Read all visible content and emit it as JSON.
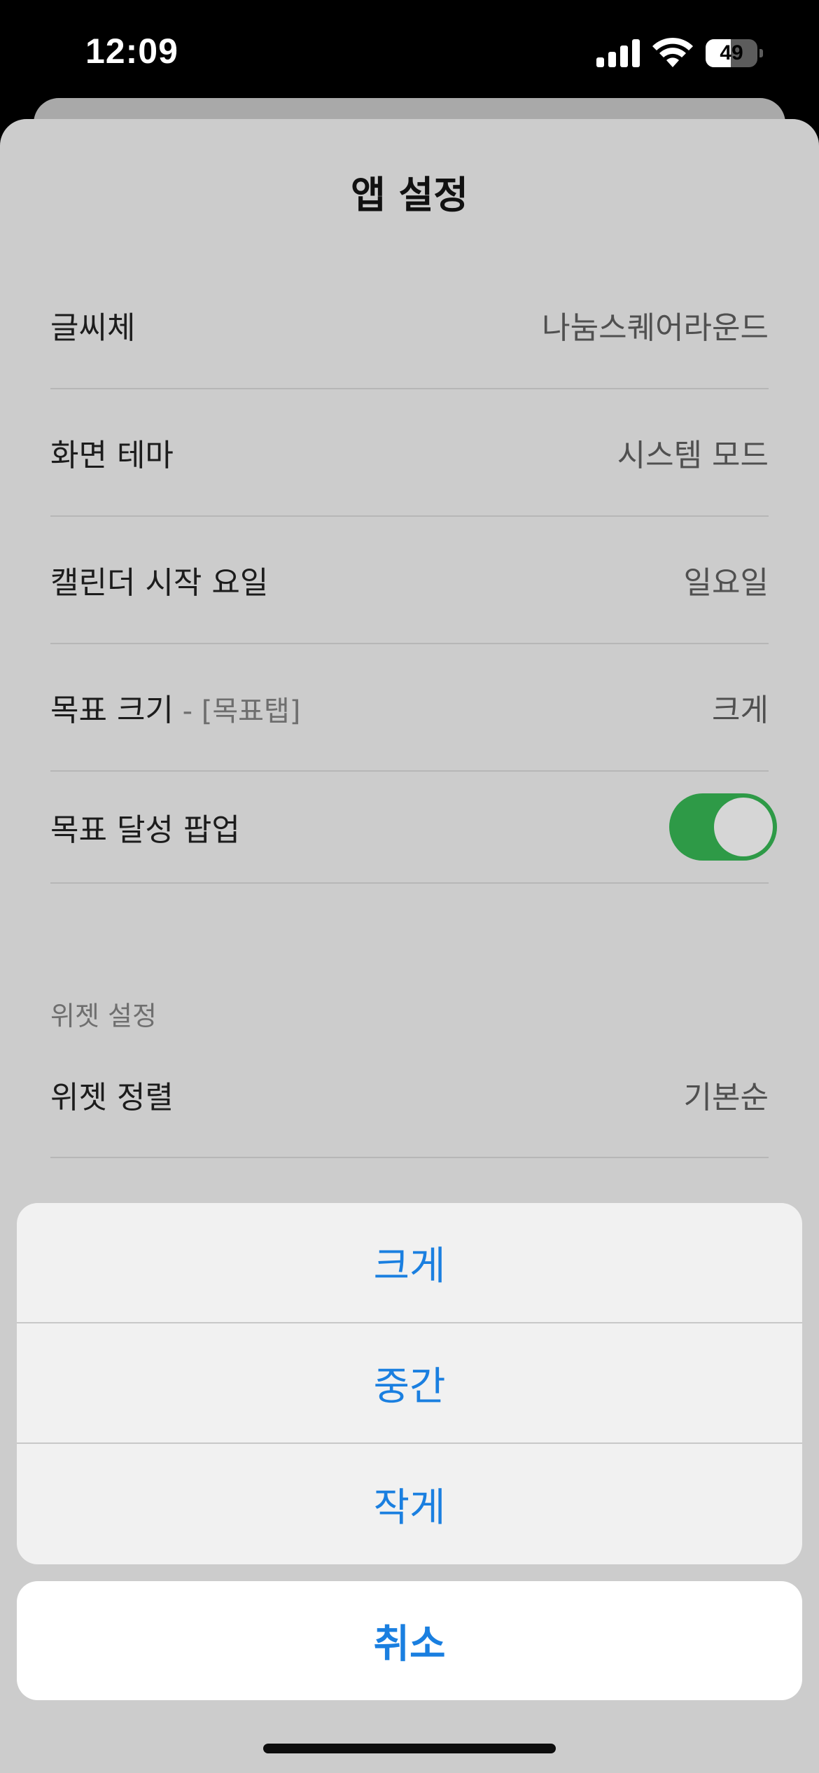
{
  "status_bar": {
    "time": "12:09",
    "battery_level": 49
  },
  "sheet": {
    "title": "앱 설정",
    "rows": [
      {
        "label": "글씨체",
        "sub": "",
        "value": "나눔스퀘어라운드"
      },
      {
        "label": "화면 테마",
        "sub": "",
        "value": "시스템 모드"
      },
      {
        "label": "캘린더 시작 요일",
        "sub": "",
        "value": "일요일"
      },
      {
        "label": "목표 크기",
        "sub": " - [목표탭]",
        "value": "크게"
      }
    ],
    "toggle_row": {
      "label": "목표 달성 팝업",
      "enabled": true
    },
    "section_header": "위젯 설정",
    "widget_row": {
      "label": "위젯 정렬",
      "value": "기본순"
    }
  },
  "action_sheet": {
    "options": [
      "크게",
      "중간",
      "작게"
    ],
    "cancel_label": "취소"
  },
  "colors": {
    "accent": "#1a7fe0",
    "toggle_on": "#2e9a47"
  }
}
